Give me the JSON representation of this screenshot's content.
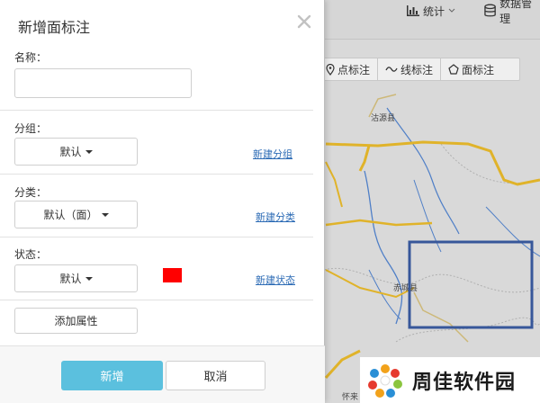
{
  "topbar": {
    "stats_label": "统计",
    "data_label": "数据管理"
  },
  "draw_toolbar": {
    "point_label": "点标注",
    "line_label": "线标注",
    "area_label": "面标注"
  },
  "map": {
    "labels": {
      "town_top": "沽源县",
      "town_mid": "赤城县",
      "bottom_text": "怀来"
    },
    "colors": {
      "road": "#e0b32a",
      "road_secondary": "#cdb878",
      "river": "#4f7fc7",
      "boundary": "#a8a8a8",
      "selection_rect": "#37579a"
    }
  },
  "dialog": {
    "title": "新增面标注",
    "name_label": "名称：",
    "name_value": "",
    "name_placeholder": "",
    "group_label": "分组：",
    "group_value": "默认",
    "new_group_link": "新建分组",
    "category_label": "分类：",
    "category_value": "默认（面）",
    "new_category_link": "新建分类",
    "status_label": "状态：",
    "status_value": "默认",
    "status_color": "#ff0000",
    "new_status_link": "新建状态",
    "add_attribute_label": "添加属性",
    "submit_label": "新增",
    "cancel_label": "取消",
    "colors": {
      "submit_bg": "#5bc0de",
      "link": "#2c6bb5"
    }
  },
  "watermark": {
    "text": "周佳软件园"
  }
}
